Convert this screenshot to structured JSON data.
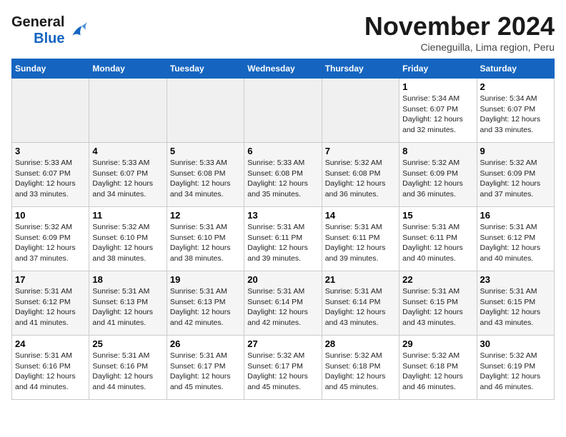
{
  "logo": {
    "line1": "General",
    "line2": "Blue"
  },
  "title": "November 2024",
  "location": "Cieneguilla, Lima region, Peru",
  "days_of_week": [
    "Sunday",
    "Monday",
    "Tuesday",
    "Wednesday",
    "Thursday",
    "Friday",
    "Saturday"
  ],
  "weeks": [
    [
      {
        "day": "",
        "info": ""
      },
      {
        "day": "",
        "info": ""
      },
      {
        "day": "",
        "info": ""
      },
      {
        "day": "",
        "info": ""
      },
      {
        "day": "",
        "info": ""
      },
      {
        "day": "1",
        "info": "Sunrise: 5:34 AM\nSunset: 6:07 PM\nDaylight: 12 hours\nand 32 minutes."
      },
      {
        "day": "2",
        "info": "Sunrise: 5:34 AM\nSunset: 6:07 PM\nDaylight: 12 hours\nand 33 minutes."
      }
    ],
    [
      {
        "day": "3",
        "info": "Sunrise: 5:33 AM\nSunset: 6:07 PM\nDaylight: 12 hours\nand 33 minutes."
      },
      {
        "day": "4",
        "info": "Sunrise: 5:33 AM\nSunset: 6:07 PM\nDaylight: 12 hours\nand 34 minutes."
      },
      {
        "day": "5",
        "info": "Sunrise: 5:33 AM\nSunset: 6:08 PM\nDaylight: 12 hours\nand 34 minutes."
      },
      {
        "day": "6",
        "info": "Sunrise: 5:33 AM\nSunset: 6:08 PM\nDaylight: 12 hours\nand 35 minutes."
      },
      {
        "day": "7",
        "info": "Sunrise: 5:32 AM\nSunset: 6:08 PM\nDaylight: 12 hours\nand 36 minutes."
      },
      {
        "day": "8",
        "info": "Sunrise: 5:32 AM\nSunset: 6:09 PM\nDaylight: 12 hours\nand 36 minutes."
      },
      {
        "day": "9",
        "info": "Sunrise: 5:32 AM\nSunset: 6:09 PM\nDaylight: 12 hours\nand 37 minutes."
      }
    ],
    [
      {
        "day": "10",
        "info": "Sunrise: 5:32 AM\nSunset: 6:09 PM\nDaylight: 12 hours\nand 37 minutes."
      },
      {
        "day": "11",
        "info": "Sunrise: 5:32 AM\nSunset: 6:10 PM\nDaylight: 12 hours\nand 38 minutes."
      },
      {
        "day": "12",
        "info": "Sunrise: 5:31 AM\nSunset: 6:10 PM\nDaylight: 12 hours\nand 38 minutes."
      },
      {
        "day": "13",
        "info": "Sunrise: 5:31 AM\nSunset: 6:11 PM\nDaylight: 12 hours\nand 39 minutes."
      },
      {
        "day": "14",
        "info": "Sunrise: 5:31 AM\nSunset: 6:11 PM\nDaylight: 12 hours\nand 39 minutes."
      },
      {
        "day": "15",
        "info": "Sunrise: 5:31 AM\nSunset: 6:11 PM\nDaylight: 12 hours\nand 40 minutes."
      },
      {
        "day": "16",
        "info": "Sunrise: 5:31 AM\nSunset: 6:12 PM\nDaylight: 12 hours\nand 40 minutes."
      }
    ],
    [
      {
        "day": "17",
        "info": "Sunrise: 5:31 AM\nSunset: 6:12 PM\nDaylight: 12 hours\nand 41 minutes."
      },
      {
        "day": "18",
        "info": "Sunrise: 5:31 AM\nSunset: 6:13 PM\nDaylight: 12 hours\nand 41 minutes."
      },
      {
        "day": "19",
        "info": "Sunrise: 5:31 AM\nSunset: 6:13 PM\nDaylight: 12 hours\nand 42 minutes."
      },
      {
        "day": "20",
        "info": "Sunrise: 5:31 AM\nSunset: 6:14 PM\nDaylight: 12 hours\nand 42 minutes."
      },
      {
        "day": "21",
        "info": "Sunrise: 5:31 AM\nSunset: 6:14 PM\nDaylight: 12 hours\nand 43 minutes."
      },
      {
        "day": "22",
        "info": "Sunrise: 5:31 AM\nSunset: 6:15 PM\nDaylight: 12 hours\nand 43 minutes."
      },
      {
        "day": "23",
        "info": "Sunrise: 5:31 AM\nSunset: 6:15 PM\nDaylight: 12 hours\nand 43 minutes."
      }
    ],
    [
      {
        "day": "24",
        "info": "Sunrise: 5:31 AM\nSunset: 6:16 PM\nDaylight: 12 hours\nand 44 minutes."
      },
      {
        "day": "25",
        "info": "Sunrise: 5:31 AM\nSunset: 6:16 PM\nDaylight: 12 hours\nand 44 minutes."
      },
      {
        "day": "26",
        "info": "Sunrise: 5:31 AM\nSunset: 6:17 PM\nDaylight: 12 hours\nand 45 minutes."
      },
      {
        "day": "27",
        "info": "Sunrise: 5:32 AM\nSunset: 6:17 PM\nDaylight: 12 hours\nand 45 minutes."
      },
      {
        "day": "28",
        "info": "Sunrise: 5:32 AM\nSunset: 6:18 PM\nDaylight: 12 hours\nand 45 minutes."
      },
      {
        "day": "29",
        "info": "Sunrise: 5:32 AM\nSunset: 6:18 PM\nDaylight: 12 hours\nand 46 minutes."
      },
      {
        "day": "30",
        "info": "Sunrise: 5:32 AM\nSunset: 6:19 PM\nDaylight: 12 hours\nand 46 minutes."
      }
    ]
  ]
}
